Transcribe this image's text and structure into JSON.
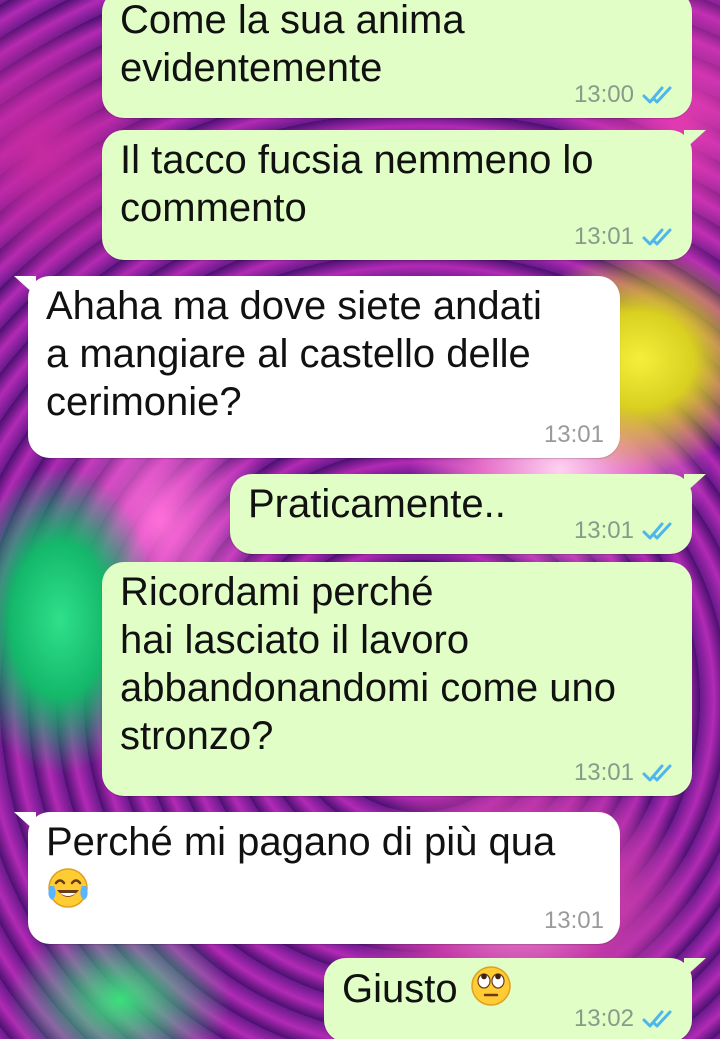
{
  "messages": [
    {
      "id": "m1",
      "direction": "out",
      "text": "Come la sua anima\nevidentemente",
      "time": "13:00",
      "status": "read"
    },
    {
      "id": "m2",
      "direction": "out",
      "text": "Il tacco fucsia nemmeno lo\ncommento",
      "time": "13:01",
      "status": "read"
    },
    {
      "id": "m3",
      "direction": "in",
      "text": "Ahaha ma dove siete andati\na mangiare al castello delle\ncerimonie?",
      "time": "13:01"
    },
    {
      "id": "m4",
      "direction": "out",
      "text": "Praticamente..",
      "time": "13:01",
      "status": "read"
    },
    {
      "id": "m5",
      "direction": "out",
      "text": "Ricordami perché\nhai lasciato il lavoro\nabbandonandomi come uno\nstronzo?",
      "time": "13:01",
      "status": "read"
    },
    {
      "id": "m6",
      "direction": "in",
      "text": "Perché mi pagano di più qua",
      "emoji": "face-with-tears-of-joy",
      "time": "13:01"
    },
    {
      "id": "m7",
      "direction": "out",
      "text": "Giusto",
      "emoji": "face-with-rolling-eyes",
      "time": "13:02",
      "status": "read"
    }
  ],
  "colors": {
    "outgoing_bubble": "#e1fec6",
    "incoming_bubble": "#ffffff",
    "read_ticks": "#4fb6ec"
  }
}
